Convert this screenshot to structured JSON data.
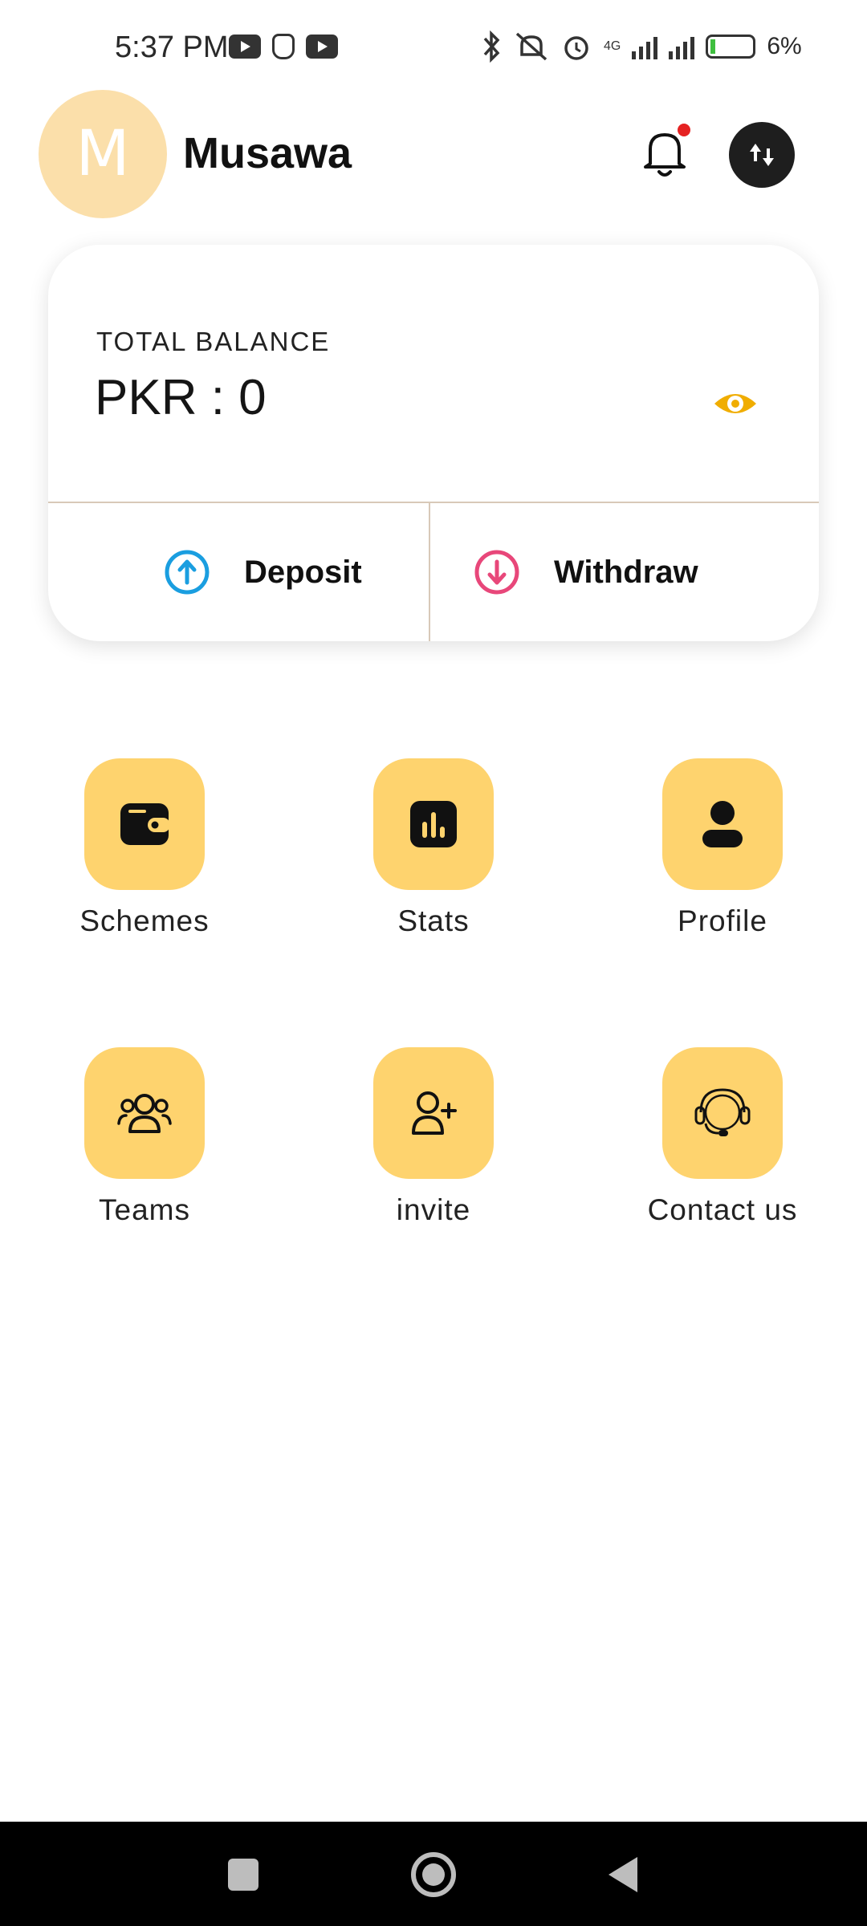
{
  "status_bar": {
    "time": "5:37 PM",
    "network": "4G",
    "battery": "6%",
    "icons": [
      "youtube-icon",
      "notification-icon",
      "youtube-icon",
      "bluetooth-icon",
      "mute-icon",
      "alarm-icon",
      "signal-icon",
      "battery-charging-icon"
    ]
  },
  "header": {
    "avatar_letter": "M",
    "username": "Musawa",
    "icons": [
      "bell-icon",
      "theme-toggle-icon"
    ]
  },
  "balance": {
    "label": "TOTAL BALANCE",
    "value": "PKR : 0",
    "deposit_label": "Deposit",
    "withdraw_label": "Withdraw"
  },
  "menu": [
    {
      "label": "Schemes",
      "icon": "wallet-icon"
    },
    {
      "label": "Stats",
      "icon": "bar-chart-icon"
    },
    {
      "label": "Profile",
      "icon": "user-icon"
    },
    {
      "label": "Teams",
      "icon": "team-icon"
    },
    {
      "label": "invite",
      "icon": "add-user-icon"
    },
    {
      "label": "Contact us",
      "icon": "headset-icon"
    }
  ],
  "colors": {
    "tile": "#fed36e",
    "avatar_bg": "#fbdfaa",
    "eye": "#f0ad00",
    "deposit": "#1a9ee0",
    "withdraw": "#e8477a",
    "notification_dot": "#e52222"
  }
}
